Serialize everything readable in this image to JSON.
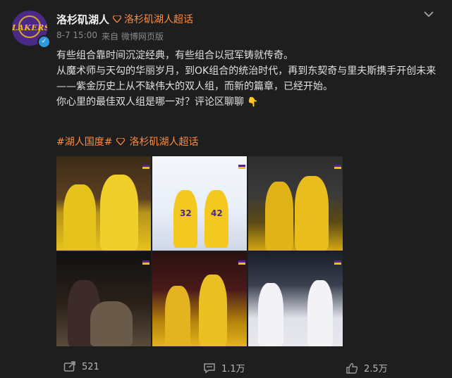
{
  "header": {
    "username": "洛杉矶湖人",
    "supertopic_label": "洛杉矶湖人超话",
    "timestamp": "8-7 15:00",
    "source": "来自 微博网页版",
    "avatar_logo_text": "LAKERS"
  },
  "post": {
    "lines": [
      "有些组合靠时间沉淀经典，有些组合以冠军铸就传奇。",
      "从魔术师与天勾的华丽岁月，到OK组合的统治时代，再到东契奇与里夫斯携手开创未来——紫金历史上从不缺伟大的双人组，而新的篇章，已经开始。",
      "你心里的最佳双人组是哪一对？评论区聊聊"
    ]
  },
  "tags": {
    "hashtag": "#湖人国度#",
    "supertopic": "洛杉矶湖人超话"
  },
  "images": [
    {
      "name": "photo-magic-kareem"
    },
    {
      "name": "photo-32-42"
    },
    {
      "name": "photo-ok-combo"
    },
    {
      "name": "photo-wilt-west"
    },
    {
      "name": "photo-kobe-gasol"
    },
    {
      "name": "photo-doncic-reaves"
    }
  ],
  "actions": {
    "repost_count": "521",
    "comment_count": "1.1万",
    "like_count": "2.5万"
  },
  "colors": {
    "accent_orange": "#ff8b3d",
    "lakers_purple": "#4a2a86",
    "lakers_gold": "#f3b81f",
    "background": "#1e1e1e"
  }
}
